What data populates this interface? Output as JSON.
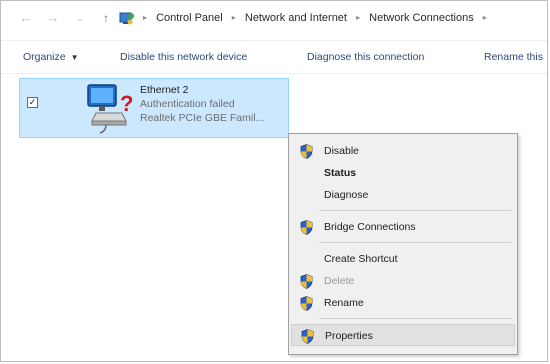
{
  "address": {
    "crumbs": [
      "Control Panel",
      "Network and Internet",
      "Network Connections"
    ]
  },
  "toolbar": {
    "organize": "Organize",
    "disable": "Disable this network device",
    "diagnose": "Diagnose this connection",
    "rename": "Rename this"
  },
  "connection": {
    "name": "Ethernet 2",
    "status": "Authentication failed",
    "adapter": "Realtek PCIe GBE Famil..."
  },
  "menu": {
    "items": [
      {
        "label": "Disable",
        "shield": true
      },
      {
        "label": "Status",
        "bold": true
      },
      {
        "label": "Diagnose"
      },
      {
        "label": "Bridge Connections",
        "shield": true
      },
      {
        "label": "Create Shortcut"
      },
      {
        "label": "Delete",
        "shield": true,
        "disabled": true
      },
      {
        "label": "Rename",
        "shield": true
      },
      {
        "label": "Properties",
        "shield": true,
        "highlighted": true
      }
    ]
  },
  "colors": {
    "selection": "#cce8ff",
    "menu_bg": "#f0f0f0",
    "link": "#2a4a7a"
  },
  "icons": [
    "back-arrow-icon",
    "forward-arrow-icon",
    "up-arrow-icon",
    "control-panel-icon",
    "network-adapter-icon",
    "uac-shield-icon"
  ]
}
